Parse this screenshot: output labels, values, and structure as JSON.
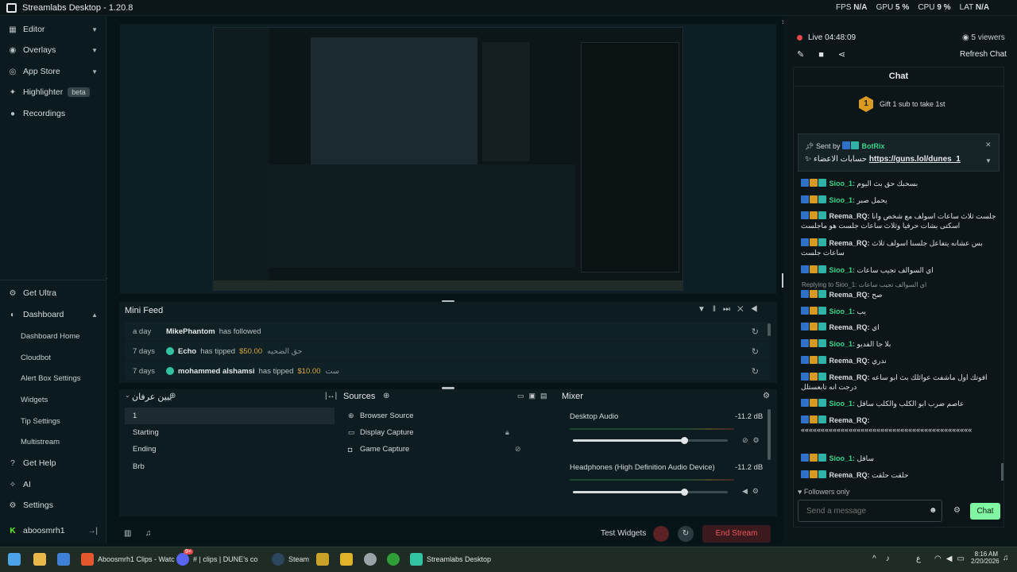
{
  "window": {
    "title": "Streamlabs Desktop - 1.20.8",
    "minimize": "—",
    "maximize": "☐",
    "close": "✕"
  },
  "stats": {
    "fps_label": "FPS",
    "fps": "N/A",
    "gpu_label": "GPU",
    "gpu": "5 %",
    "cpu_label": "CPU",
    "cpu": "9 %",
    "lat_label": "LAT",
    "lat": "N/A"
  },
  "sidebar": {
    "top": [
      {
        "label": "Editor",
        "icon": "editor-icon"
      },
      {
        "label": "Overlays",
        "icon": "overlays-icon"
      },
      {
        "label": "App Store",
        "icon": "app-store-icon"
      },
      {
        "label": "Highlighter",
        "icon": "highlighter-icon",
        "badge": "beta"
      },
      {
        "label": "Recordings",
        "icon": "recordings-icon"
      }
    ],
    "bottom": [
      {
        "label": "Get Ultra"
      },
      {
        "label": "Dashboard"
      },
      {
        "label": "Dashboard Home"
      },
      {
        "label": "Cloudbot"
      },
      {
        "label": "Alert Box Settings"
      },
      {
        "label": "Widgets"
      },
      {
        "label": "Tip Settings"
      },
      {
        "label": "Multistream"
      },
      {
        "label": "Get Help"
      },
      {
        "label": "AI"
      },
      {
        "label": "Settings"
      }
    ],
    "user": "aboosmrh1"
  },
  "minifeed": {
    "title": "Mini Feed",
    "rows": [
      {
        "when": "a day",
        "name": "MikePhantom",
        "action": "has followed",
        "amount": "",
        "message": ""
      },
      {
        "when": "7 days",
        "name": "Echo",
        "action": "has tipped",
        "amount": "$50.00",
        "message": "حق الضحيه"
      },
      {
        "when": "7 days",
        "name": "mohammed alshamsi",
        "action": "has tipped",
        "amount": "$10.00",
        "message": "ست"
      }
    ]
  },
  "scenes": {
    "title": "بيين عرفان",
    "items": [
      "1",
      "Starting",
      "Ending",
      "Brb"
    ]
  },
  "sources": {
    "title": "Sources",
    "items": [
      "Browser Source",
      "Display Capture",
      "Game Capture"
    ]
  },
  "mixer": {
    "title": "Mixer",
    "channels": [
      {
        "name": "Desktop Audio",
        "db": "-11.2 dB",
        "level": 0.72
      },
      {
        "name": "Headphones (High Definition Audio Device)",
        "db": "-11.2 dB",
        "level": 0.72
      }
    ]
  },
  "controls": {
    "test_widgets": "Test Widgets",
    "end_stream": "End Stream"
  },
  "live": {
    "status": "Live",
    "time": "04:48:09",
    "viewers": "5 viewers",
    "refresh": "Refresh Chat"
  },
  "chat": {
    "title": "Chat",
    "gift": "Gift 1 sub to take 1st",
    "gift_number": "1",
    "pinned_sentby": "Sent by",
    "pinned_user": "BotRix",
    "pinned_text": "حسابات الاعضاء",
    "pinned_link": "https://guns.lol/dunes_1",
    "messages": [
      {
        "user": "Sioo_1:",
        "text": "بسحبك حق بث اليوم",
        "color": "g"
      },
      {
        "user": "Sioo_1:",
        "text": "يحمل صبر",
        "color": "g"
      },
      {
        "user": "Reema_RQ:",
        "text": "جلست ثلاث ساعات اسولف مع شخص وانا اسكتى بشات حرفيا وثلاث ساعات جلست هو ماجلست",
        "color": "w"
      },
      {
        "user": "Reema_RQ:",
        "text": "بس عشانه يتفاعل جلسنا اسولف ثلاث ساعات جلست",
        "color": "w"
      },
      {
        "user": "Sioo_1:",
        "text": "اي السوالف تجيب ساعات",
        "color": "g"
      },
      {
        "user": "Reema_RQ:",
        "text": "صح",
        "color": "w"
      },
      {
        "user": "Sioo_1:",
        "text": "يب",
        "color": "g"
      },
      {
        "user": "Reema_RQ:",
        "text": "اي",
        "color": "w"
      },
      {
        "user": "Sioo_1:",
        "text": "بلا جا الفديو",
        "color": "g"
      },
      {
        "user": "Reema_RQ:",
        "text": "ندري",
        "color": "w"
      },
      {
        "user": "Reema_RQ:",
        "text": "افوتك اول ماشفت عوائلك بث ابو ساعه درجت انه تابعستلل",
        "color": "w"
      },
      {
        "user": "Sioo_1:",
        "text": "عاصم ضرب ابو الكلب والكلب سافل",
        "color": "g"
      },
      {
        "user": "Reema_RQ:",
        "text": "«««««««««««««««««««««««««««««««««««««««««««",
        "color": "w"
      },
      {
        "user": "Sioo_1:",
        "text": "سافل",
        "color": "g"
      },
      {
        "user": "Reema_RQ:",
        "text": "حلقت حلقت",
        "color": "w"
      }
    ],
    "replying": "Replying to Sioo_1: اي السوالف تجيب ساعات",
    "followers_only": "Followers only",
    "placeholder": "Send a message",
    "send": "Chat"
  },
  "taskbar": {
    "items": [
      "Aboosmrh1 Clips - Watc",
      "# | clips | DUNE's co",
      "Steam",
      "Streamlabs Desktop"
    ],
    "time": "8:16 AM",
    "date": "2/20/2026",
    "lang": "ع",
    "discord_badge": "9+"
  },
  "colors": {
    "accent": "#31c3a2",
    "live": "#e5484d",
    "end_stream": "#3a1a1c",
    "chat_send": "#80f5a2"
  }
}
